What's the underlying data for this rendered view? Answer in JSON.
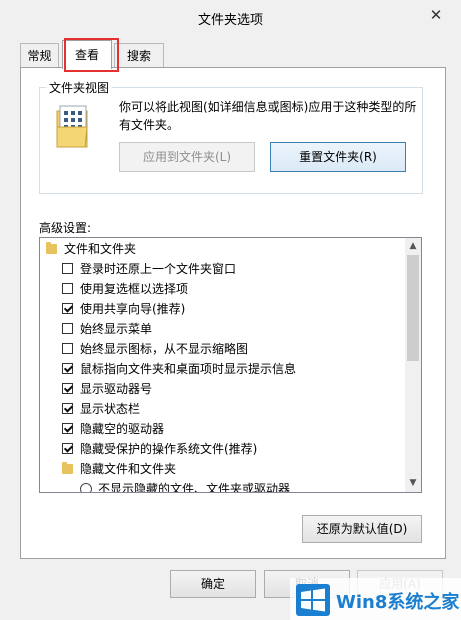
{
  "window": {
    "title": "文件夹选项",
    "close_glyph": "✕"
  },
  "tabs": [
    {
      "label": "常规"
    },
    {
      "label": "查看"
    },
    {
      "label": "搜索"
    }
  ],
  "folder_views": {
    "group_label": "文件夹视图",
    "description": "你可以将此视图(如详细信息或图标)应用于这种类型的所有文件夹。",
    "apply_button": "应用到文件夹(L)",
    "reset_button": "重置文件夹(R)"
  },
  "advanced": {
    "label": "高级设置:",
    "items": [
      {
        "kind": "folder",
        "indent": 0,
        "label": "文件和文件夹"
      },
      {
        "kind": "checkbox",
        "indent": 1,
        "checked": false,
        "label": "登录时还原上一个文件夹窗口"
      },
      {
        "kind": "checkbox",
        "indent": 1,
        "checked": false,
        "label": "使用复选框以选择项"
      },
      {
        "kind": "checkbox",
        "indent": 1,
        "checked": true,
        "label": "使用共享向导(推荐)"
      },
      {
        "kind": "checkbox",
        "indent": 1,
        "checked": false,
        "label": "始终显示菜单"
      },
      {
        "kind": "checkbox",
        "indent": 1,
        "checked": false,
        "label": "始终显示图标，从不显示缩略图"
      },
      {
        "kind": "checkbox",
        "indent": 1,
        "checked": true,
        "label": "鼠标指向文件夹和桌面项时显示提示信息"
      },
      {
        "kind": "checkbox",
        "indent": 1,
        "checked": true,
        "label": "显示驱动器号"
      },
      {
        "kind": "checkbox",
        "indent": 1,
        "checked": true,
        "label": "显示状态栏"
      },
      {
        "kind": "checkbox",
        "indent": 1,
        "checked": true,
        "label": "隐藏空的驱动器"
      },
      {
        "kind": "checkbox",
        "indent": 1,
        "checked": true,
        "label": "隐藏受保护的操作系统文件(推荐)"
      },
      {
        "kind": "folder",
        "indent": 1,
        "label": "隐藏文件和文件夹"
      },
      {
        "kind": "radio",
        "indent": 2,
        "checked": false,
        "label": "不显示隐藏的文件、文件夹或驱动器"
      }
    ],
    "restore_defaults_button": "还原为默认值(D)"
  },
  "footer": {
    "ok_button": "确定",
    "cancel_button": "取消",
    "apply_button": "应用(A)"
  },
  "watermark": {
    "text": "Win8系统之家"
  },
  "colors": {
    "highlight_border": "#e53030",
    "focus_border": "#3c7fb1",
    "watermark_blue": "#1a7fd0"
  }
}
